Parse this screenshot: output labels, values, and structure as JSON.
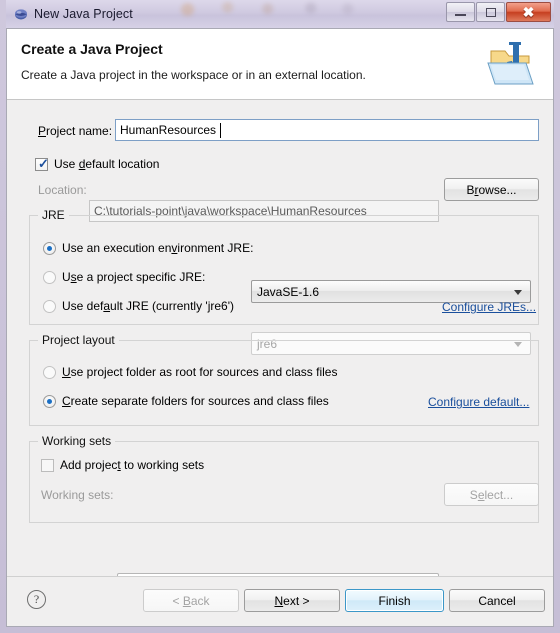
{
  "window": {
    "title": "New Java Project",
    "title_icon": "java-project-icon",
    "controls": {
      "minimize": "minimize-icon",
      "maximize": "maximize-icon",
      "close": "close-icon"
    }
  },
  "banner": {
    "title": "Create a Java Project",
    "subtitle": "Create a Java project in the workspace or in an external location.",
    "icon": "new-java-project-wizard-icon"
  },
  "form": {
    "project_name_label": "Project name:",
    "project_name_value": "HumanResources",
    "use_default_location_label": "Use default location",
    "use_default_location_checked": true,
    "location_label": "Location:",
    "location_value": "C:\\tutorials-point\\java\\workspace\\HumanResources",
    "location_enabled": false,
    "browse_label": "Browse..."
  },
  "jre": {
    "group_label": "JRE",
    "option_execution_env_label": "Use an execution environment JRE:",
    "option_execution_env_selected": true,
    "execution_env_value": "JavaSE-1.6",
    "option_project_specific_label": "Use a project specific JRE:",
    "option_project_specific_selected": false,
    "project_specific_value": "jre6",
    "option_default_jre_label": "Use default JRE (currently 'jre6')",
    "option_default_jre_selected": false,
    "configure_link": "Configure JREs..."
  },
  "project_layout": {
    "group_label": "Project layout",
    "option_project_folder_label": "Use project folder as root for sources and class files",
    "option_project_folder_selected": false,
    "option_separate_folders_label": "Create separate folders for sources and class files",
    "option_separate_folders_selected": true,
    "configure_link": "Configure default..."
  },
  "working_sets": {
    "group_label": "Working sets",
    "add_project_label": "Add project to working sets",
    "add_project_checked": false,
    "working_sets_label": "Working sets:",
    "working_sets_value": "",
    "select_label": "Select..."
  },
  "footer": {
    "help_label": "?",
    "back_label": "< Back",
    "back_enabled": false,
    "next_label": "Next >",
    "finish_label": "Finish",
    "finish_is_default": true,
    "cancel_label": "Cancel"
  },
  "colors": {
    "link": "#1a4f9c",
    "default_button_border": "#3c97c8",
    "radio_dot": "#1b6fc4",
    "dialog_bg": "#f0efef",
    "banner_bg": "#ffffff",
    "frame": "#cfc8dd",
    "close_button": "#c63f20"
  }
}
